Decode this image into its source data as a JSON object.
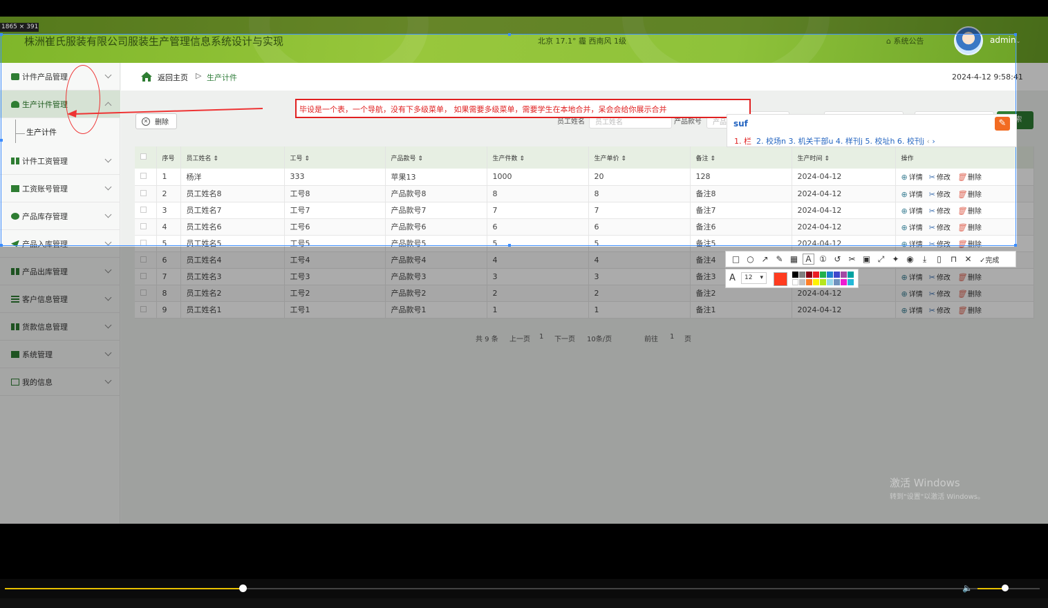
{
  "capture": {
    "size_label": "1865 × 391"
  },
  "header": {
    "title": "株洲崔氏服装有限公司服装生产管理信息系统设计与实现",
    "weather": "北京 17.1° 霾 西南风 1级",
    "notice": "系统公告",
    "user": "admin"
  },
  "sidebar": {
    "items": [
      {
        "label": "计件产品管理",
        "icon": "camera-icon"
      },
      {
        "label": "生产计件管理",
        "icon": "person-icon",
        "active": true
      },
      {
        "label": "计件工资管理",
        "icon": "grid-icon"
      },
      {
        "label": "工资账号管理",
        "icon": "chat-icon"
      },
      {
        "label": "产品库存管理",
        "icon": "pin-icon"
      },
      {
        "label": "产品入库管理",
        "icon": "send-icon"
      },
      {
        "label": "产品出库管理",
        "icon": "grid-icon"
      },
      {
        "label": "客户信息管理",
        "icon": "list-icon"
      },
      {
        "label": "货款信息管理",
        "icon": "grid-icon"
      },
      {
        "label": "系统管理",
        "icon": "chart-icon"
      },
      {
        "label": "我的信息",
        "icon": "calendar-icon"
      }
    ],
    "sub_item": "生产计件"
  },
  "breadcrumb": {
    "home": "返回主页",
    "sep": "▷",
    "current": "生产计件"
  },
  "clock": "2024-4-12 9:58:41",
  "toolbar": {
    "delete": "删除"
  },
  "filters": [
    {
      "label": "员工姓名",
      "placeholder": "员工姓名"
    },
    {
      "label": "产品款号",
      "placeholder": "产品"
    }
  ],
  "search_label": "搜索",
  "table": {
    "headers": [
      "序号",
      "员工姓名",
      "工号",
      "产品款号",
      "生产件数",
      "生产单价",
      "备注",
      "生产时间",
      "操作"
    ],
    "rows": [
      [
        "1",
        "杨洋",
        "333",
        "苹果13",
        "1000",
        "20",
        "128",
        "2024-04-12"
      ],
      [
        "2",
        "员工姓名8",
        "工号8",
        "产品款号8",
        "8",
        "8",
        "备注8",
        "2024-04-12"
      ],
      [
        "3",
        "员工姓名7",
        "工号7",
        "产品款号7",
        "7",
        "7",
        "备注7",
        "2024-04-12"
      ],
      [
        "4",
        "员工姓名6",
        "工号6",
        "产品款号6",
        "6",
        "6",
        "备注6",
        "2024-04-12"
      ],
      [
        "5",
        "员工姓名5",
        "工号5",
        "产品款号5",
        "5",
        "5",
        "备注5",
        "2024-04-12"
      ],
      [
        "6",
        "员工姓名4",
        "工号4",
        "产品款号4",
        "4",
        "4",
        "备注4",
        "2024-04-12"
      ],
      [
        "7",
        "员工姓名3",
        "工号3",
        "产品款号3",
        "3",
        "3",
        "备注3",
        "2024-04-12"
      ],
      [
        "8",
        "员工姓名2",
        "工号2",
        "产品款号2",
        "2",
        "2",
        "备注2",
        "2024-04-12"
      ],
      [
        "9",
        "员工姓名1",
        "工号1",
        "产品款号1",
        "1",
        "1",
        "备注1",
        "2024-04-12"
      ]
    ],
    "ops": {
      "detail": "详情",
      "edit": "修改",
      "delete": "删除"
    }
  },
  "pager": {
    "total": "共 9 条",
    "prev": "上一页",
    "page": "1",
    "next": "下一页",
    "size": "10条/页",
    "goto": "前往",
    "goto_page": "1",
    "unit": "页"
  },
  "annotation": {
    "text": "毕设是一个表，一个导航，没有下多级菜单， 如果需要多级菜单，需要学生在本地合并，呆会会给你展示合并"
  },
  "ime": {
    "input": "suf",
    "candidates": "2. 校场n  3. 机关干部u  4. 样刊j  5. 校址h  6. 校刊j",
    "first": "1. 栏"
  },
  "screenshot_toolbar": {
    "done": "完成",
    "font_size": "12"
  },
  "watermark": {
    "line1": "激活 Windows",
    "line2": "转到\"设置\"以激活 Windows。"
  },
  "player": {
    "progress": 0.23,
    "volume": 0.45
  }
}
